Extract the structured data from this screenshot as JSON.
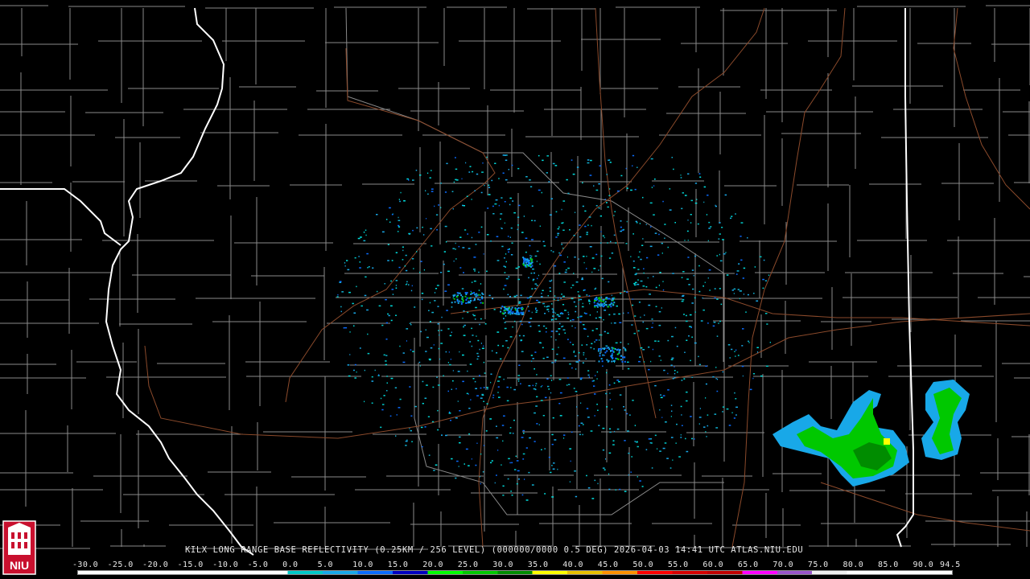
{
  "caption": {
    "text": "KILX LONG RANGE BASE REFLECTIVITY (0.25KM / 256 LEVEL) (000000/0000 0.5 DEG) 2026-04-03 14:41 UTC  ATLAS.NIU.EDU"
  },
  "scale": {
    "labels": [
      "-30.0",
      "-25.0",
      "-20.0",
      "-15.0",
      "-10.0",
      "-5.0",
      "0.0",
      "5.0",
      "10.0",
      "15.0",
      "20.0",
      "25.0",
      "30.0",
      "35.0",
      "40.0",
      "45.0",
      "50.0",
      "55.0",
      "60.0",
      "65.0",
      "70.0",
      "75.0",
      "80.0",
      "85.0",
      "90.0",
      "94.5"
    ],
    "colors": [
      "#ffffff",
      "#ffffff",
      "#ffffff",
      "#ffffff",
      "#ffffff",
      "#ffffff",
      "#00c8c8",
      "#18a8e8",
      "#0a6cff",
      "#0000c0",
      "#00ff00",
      "#00c800",
      "#008c00",
      "#ffff00",
      "#e8c000",
      "#ff9000",
      "#ff0000",
      "#d60000",
      "#c00000",
      "#ff00ff",
      "#9955c9",
      "#f0f0f0",
      "#ffffff",
      "#ffffff",
      "#ffffff"
    ]
  },
  "logo": {
    "text": "NIU",
    "color": "#c8102e"
  },
  "map": {
    "state_line_color": "#ffffff",
    "county_line_color": "#8a8a8a",
    "highway_color": "#8b4a2b",
    "radar_site": "KILX"
  }
}
